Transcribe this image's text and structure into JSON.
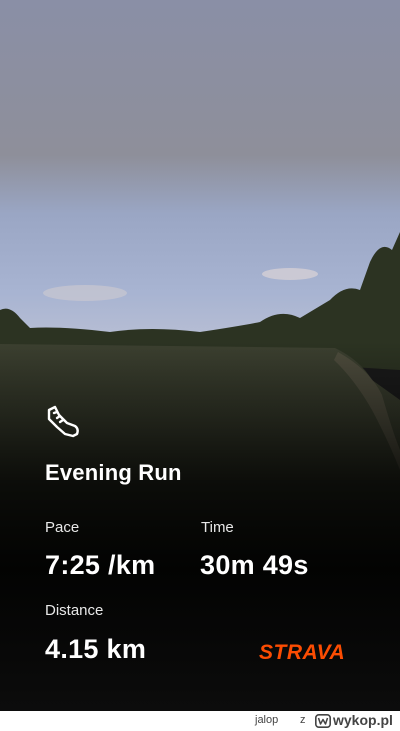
{
  "activity": {
    "title": "Evening Run",
    "icon": "running-shoe-icon"
  },
  "stats": {
    "pace_label": "Pace",
    "pace_value": "7:25 /km",
    "time_label": "Time",
    "time_value": "30m 49s",
    "distance_label": "Distance",
    "distance_value": "4.15 km"
  },
  "brand": {
    "name": "STRAVA",
    "color": "#fc4c02"
  },
  "footer": {
    "user": "jalop",
    "from": "z",
    "site": "wykop.pl"
  }
}
